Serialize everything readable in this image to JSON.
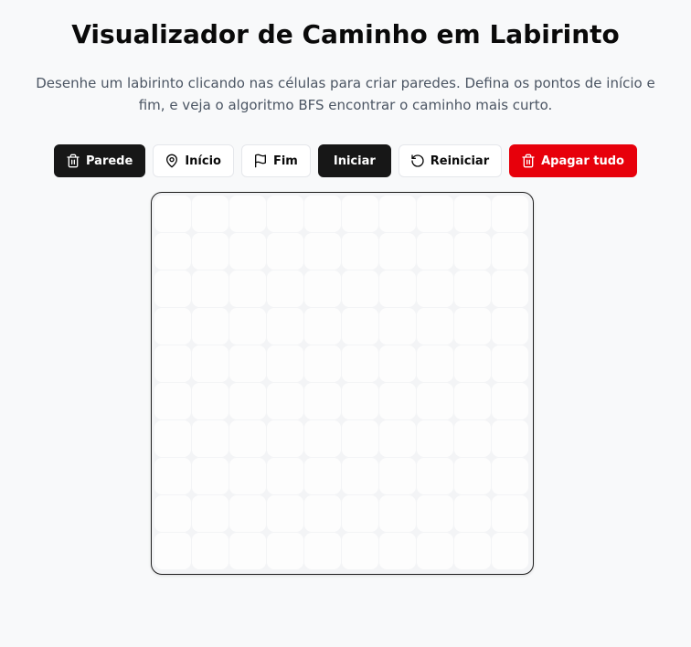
{
  "header": {
    "title": "Visualizador de Caminho em Labirinto",
    "description": "Desenhe um labirinto clicando nas células para criar paredes. Defina os pontos de início e fim, e veja o algoritmo BFS encontrar o caminho mais curto."
  },
  "toolbar": {
    "wall_label": "Parede",
    "wall_icon": "trash-icon",
    "start_label": "Início",
    "start_icon": "map-pin-icon",
    "end_label": "Fim",
    "end_icon": "flag-icon",
    "run_label": "Iniciar",
    "reset_label": "Reiniciar",
    "reset_icon": "rotate-ccw-icon",
    "clear_label": "Apagar tudo",
    "clear_icon": "trash-icon"
  },
  "grid": {
    "rows": 10,
    "cols": 10
  },
  "colors": {
    "primary": "#171717",
    "danger": "#e7000b",
    "background": "#f8f9fa",
    "cell": "#fdfdfd"
  }
}
